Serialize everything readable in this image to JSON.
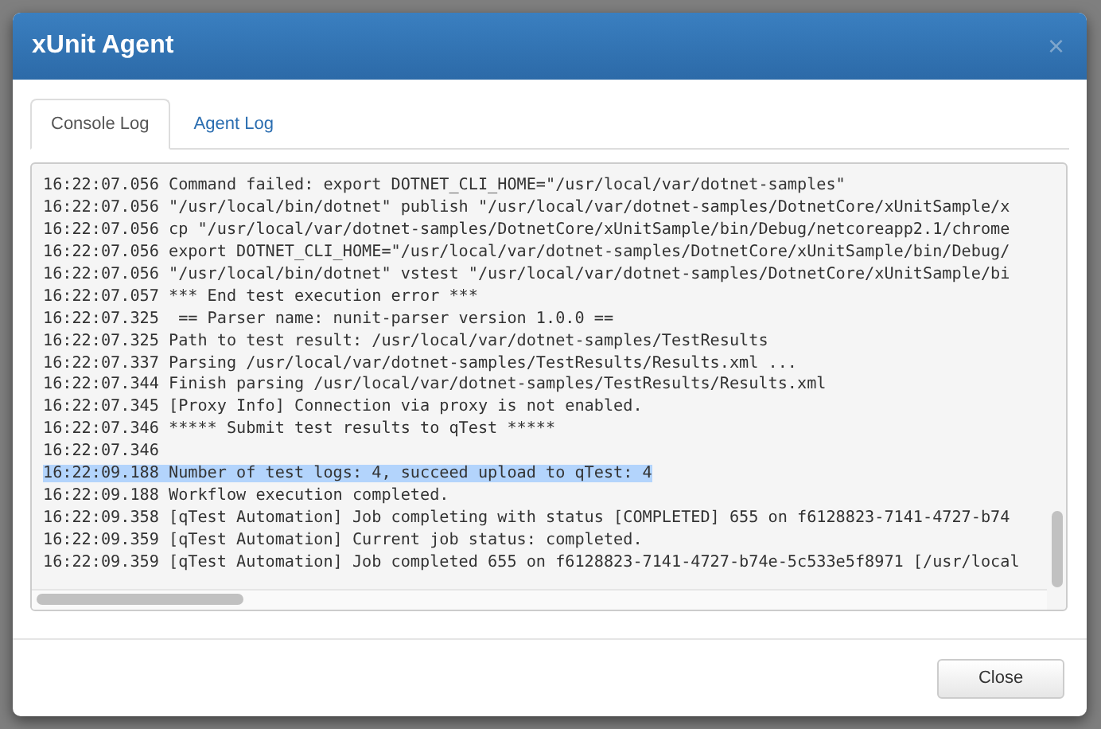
{
  "dialog": {
    "title": "xUnit Agent",
    "close_icon": "×",
    "tabs": [
      {
        "label": "Console Log",
        "selected": true
      },
      {
        "label": "Agent Log",
        "selected": false
      }
    ],
    "log_lines": [
      {
        "text": "16:22:07.056 Command failed: export DOTNET_CLI_HOME=\"/usr/local/var/dotnet-samples\"",
        "selected": false
      },
      {
        "text": "16:22:07.056 \"/usr/local/bin/dotnet\" publish \"/usr/local/var/dotnet-samples/DotnetCore/xUnitSample/x",
        "selected": false
      },
      {
        "text": "16:22:07.056 cp \"/usr/local/var/dotnet-samples/DotnetCore/xUnitSample/bin/Debug/netcoreapp2.1/chrome",
        "selected": false
      },
      {
        "text": "16:22:07.056 export DOTNET_CLI_HOME=\"/usr/local/var/dotnet-samples/DotnetCore/xUnitSample/bin/Debug/",
        "selected": false
      },
      {
        "text": "16:22:07.056 \"/usr/local/bin/dotnet\" vstest \"/usr/local/var/dotnet-samples/DotnetCore/xUnitSample/bi",
        "selected": false
      },
      {
        "text": "16:22:07.057 *** End test execution error ***",
        "selected": false
      },
      {
        "text": "16:22:07.325  == Parser name: nunit-parser version 1.0.0 ==",
        "selected": false
      },
      {
        "text": "16:22:07.325 Path to test result: /usr/local/var/dotnet-samples/TestResults",
        "selected": false
      },
      {
        "text": "16:22:07.337 Parsing /usr/local/var/dotnet-samples/TestResults/Results.xml ...",
        "selected": false
      },
      {
        "text": "16:22:07.344 Finish parsing /usr/local/var/dotnet-samples/TestResults/Results.xml",
        "selected": false
      },
      {
        "text": "16:22:07.345 [Proxy Info] Connection via proxy is not enabled.",
        "selected": false
      },
      {
        "text": "16:22:07.346 ***** Submit test results to qTest *****",
        "selected": false
      },
      {
        "text": "16:22:07.346",
        "selected": false
      },
      {
        "text": "16:22:09.188 Number of test logs: 4, succeed upload to qTest: 4",
        "selected": true
      },
      {
        "text": "16:22:09.188 Workflow execution completed.",
        "selected": false
      },
      {
        "text": "16:22:09.358 [qTest Automation] Job completing with status [COMPLETED] 655 on f6128823-7141-4727-b74",
        "selected": false
      },
      {
        "text": "16:22:09.359 [qTest Automation] Current job status: completed.",
        "selected": false
      },
      {
        "text": "16:22:09.359 [qTest Automation] Job completed 655 on f6128823-7141-4727-b74e-5c533e5f8971 [/usr/local",
        "selected": false
      }
    ],
    "buttons": [
      {
        "label": "Close"
      }
    ]
  }
}
